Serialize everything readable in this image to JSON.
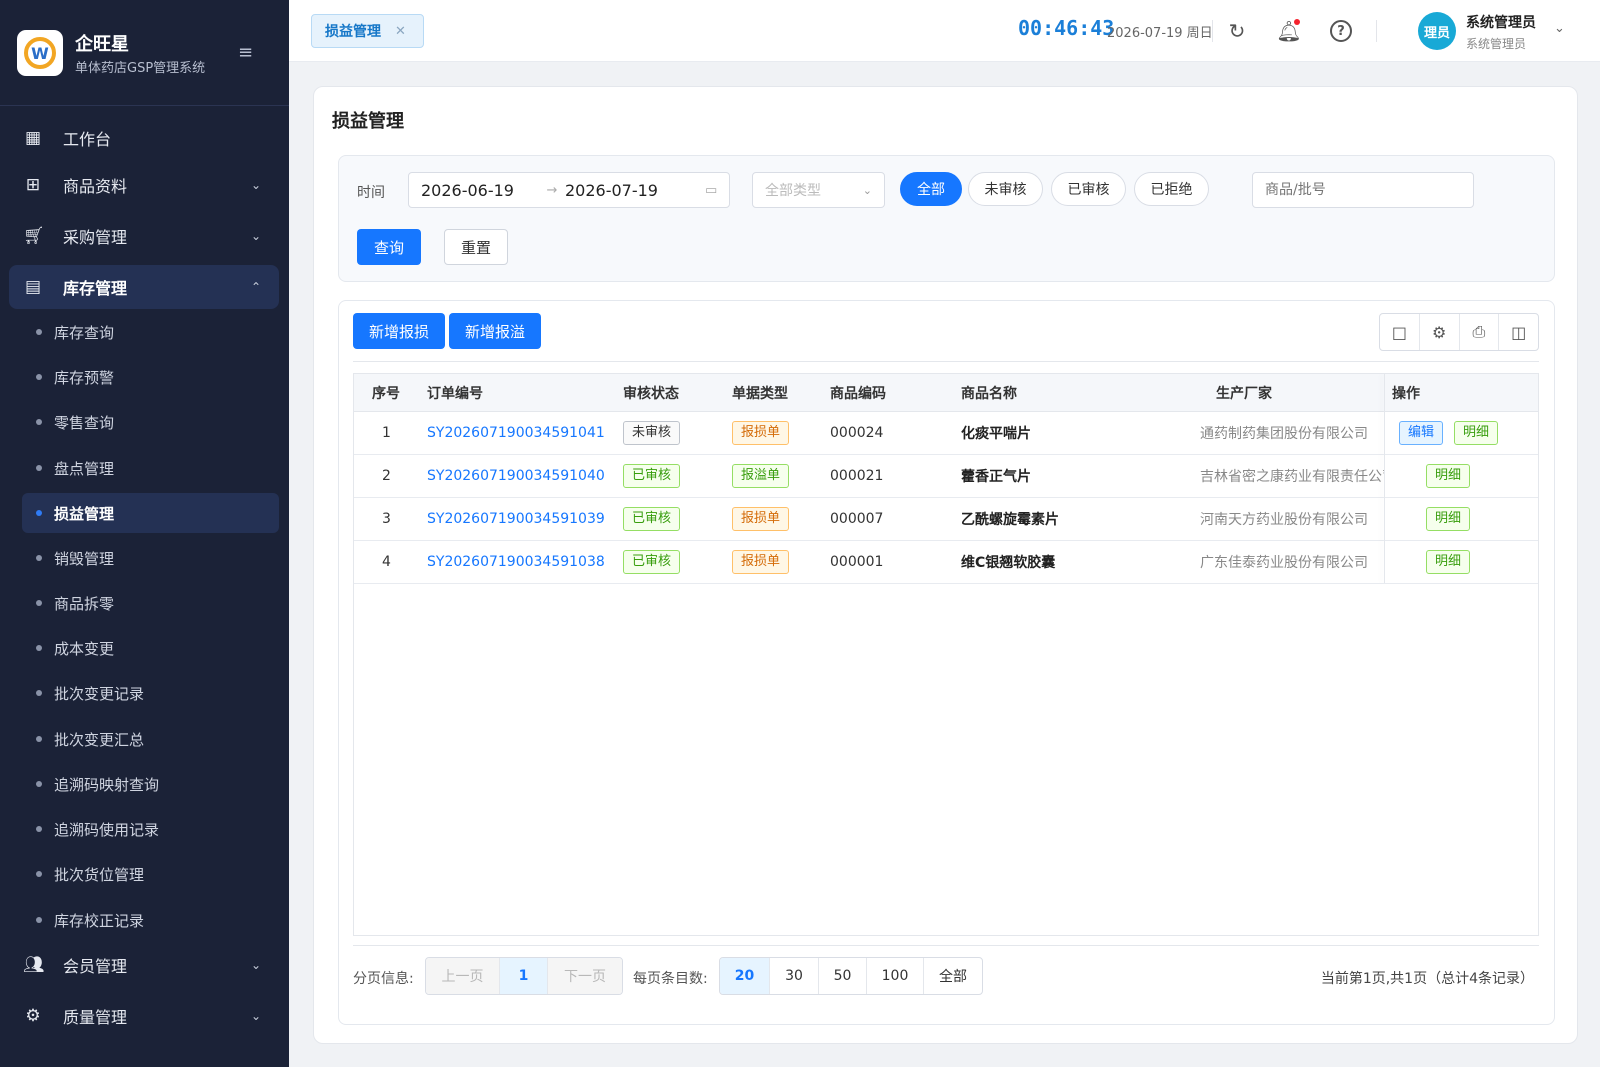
{
  "brand": {
    "title": "企旺星",
    "subtitle": "单体药店GSP管理系统",
    "logo_letter": "W"
  },
  "sidebar": {
    "menus": [
      {
        "label": "工作台",
        "icon": "dashboard-icon"
      },
      {
        "label": "商品资料",
        "icon": "product-icon"
      },
      {
        "label": "采购管理",
        "icon": "cart-icon"
      },
      {
        "label": "库存管理",
        "icon": "warehouse-icon"
      },
      {
        "label": "会员管理",
        "icon": "members-icon"
      },
      {
        "label": "质量管理",
        "icon": "quality-icon"
      }
    ],
    "submenu": [
      "库存查询",
      "库存预警",
      "零售查询",
      "盘点管理",
      "损益管理",
      "销毁管理",
      "商品拆零",
      "成本变更",
      "批次变更记录",
      "批次变更汇总",
      "追溯码映射查询",
      "追溯码使用记录",
      "批次货位管理",
      "库存校正记录"
    ]
  },
  "topbar": {
    "tab_label": "损益管理",
    "clock": "00:46:43",
    "date": "2026-07-19 周日",
    "avatar_text": "理员",
    "user_name": "系统管理员",
    "user_role": "系统管理员"
  },
  "page": {
    "title": "损益管理",
    "filter": {
      "time_label": "时间",
      "date_start": "2026-06-19",
      "date_end": "2026-07-19",
      "type_placeholder": "全部类型",
      "status_options": [
        "全部",
        "未审核",
        "已审核",
        "已拒绝"
      ],
      "selected_status": "全部",
      "search_placeholder": "商品/批号",
      "query_label": "查询",
      "reset_label": "重置"
    },
    "actions": {
      "add_loss": "新增报损",
      "add_overflow": "新增报溢"
    },
    "table": {
      "headers": [
        "序号",
        "订单编号",
        "审核状态",
        "单据类型",
        "商品编码",
        "商品名称",
        "生产厂家",
        "操作"
      ],
      "rows": [
        {
          "no": "1",
          "order": "SY202607190034591041",
          "status": "未审核",
          "type": "报损单",
          "code": "000024",
          "name": "化痰平喘片",
          "maker": "通药制药集团股份有限公司",
          "ops": [
            "编辑",
            "明细"
          ]
        },
        {
          "no": "2",
          "order": "SY202607190034591040",
          "status": "已审核",
          "type": "报溢单",
          "code": "000021",
          "name": "藿香正气片",
          "maker": "吉林省密之康药业有限责任公司",
          "ops": [
            "明细"
          ]
        },
        {
          "no": "3",
          "order": "SY202607190034591039",
          "status": "已审核",
          "type": "报损单",
          "code": "000007",
          "name": "乙酰螺旋霉素片",
          "maker": "河南天方药业股份有限公司",
          "ops": [
            "明细"
          ]
        },
        {
          "no": "4",
          "order": "SY202607190034591038",
          "status": "已审核",
          "type": "报损单",
          "code": "000001",
          "name": "维C银翘软胶囊",
          "maker": "广东佳泰药业股份有限公司",
          "ops": [
            "明细"
          ]
        }
      ]
    },
    "pagination": {
      "label": "分页信息:",
      "prev": "上一页",
      "current": "1",
      "next": "下一页",
      "size_label": "每页条目数:",
      "sizes": [
        "20",
        "30",
        "50",
        "100",
        "全部"
      ],
      "selected_size": "20",
      "info": "当前第1页,共1页（总计4条记录）"
    }
  }
}
